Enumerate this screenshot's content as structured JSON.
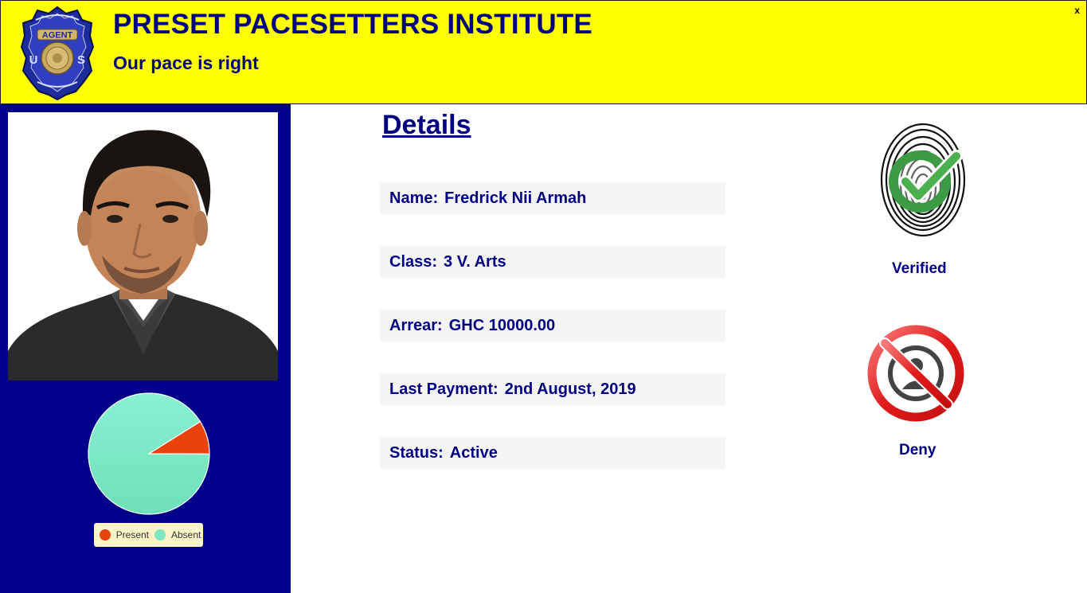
{
  "header": {
    "title": "PRESET PACESETTERS INSTITUTE",
    "subtitle": "Our pace is right",
    "close_label": "x",
    "badge_icon": "police-badge-icon",
    "background_color": "#ffff00",
    "text_color": "#000080"
  },
  "sidebar": {
    "background_color": "#00008b",
    "photo_icon": "student-photo",
    "attendance": {
      "legend": [
        {
          "label": "Present",
          "color": "#e8430e"
        },
        {
          "label": "Absent",
          "color": "#7ee8c4"
        }
      ]
    }
  },
  "chart_data": {
    "type": "pie",
    "slices": [
      {
        "label": "Present",
        "value": 9,
        "color": "#e8430e"
      },
      {
        "label": "Absent",
        "value": 91,
        "color": "#7ee8c4"
      }
    ],
    "legend_position": "bottom"
  },
  "details": {
    "heading": "Details",
    "fields": [
      {
        "label": "Name:",
        "value": "Fredrick Nii Armah"
      },
      {
        "label": "Class:",
        "value": "3 V. Arts"
      },
      {
        "label": "Arrear:",
        "value": "GHC 10000.00"
      },
      {
        "label": "Last Payment:",
        "value": "2nd August, 2019"
      },
      {
        "label": "Status:",
        "value": "Active"
      }
    ]
  },
  "verification": {
    "fingerprint_icon": "fingerprint-check-icon",
    "verified_label": "Verified",
    "deny_icon": "no-person-icon",
    "deny_label": "Deny"
  }
}
